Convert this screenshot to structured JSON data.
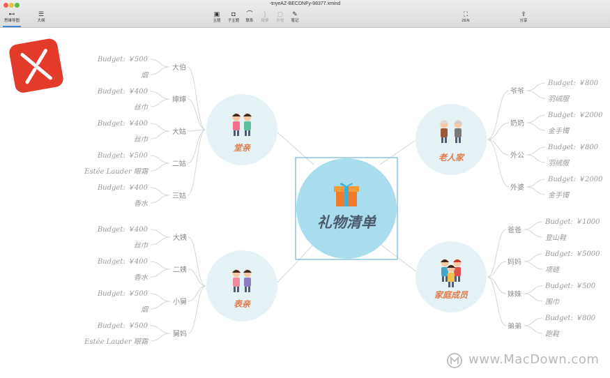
{
  "window": {
    "title": "-tnyeAZ-BECDNFy-98377.xmind"
  },
  "toolbar": {
    "mindmap_label": "思维导图",
    "outline_label": "大纲",
    "topic_label": "主题",
    "subtopic_label": "子主题",
    "relation_label": "联系",
    "summary_label": "概要",
    "boundary_label": "外框",
    "note_label": "笔记",
    "zen_label": "ZEN",
    "share_label": "分享"
  },
  "colors": {
    "accent": "#3a86d4",
    "bubble": "#e4f2f6",
    "center": "#a9dcec",
    "branch_label": "#e07a4a",
    "leaf_text": "#9a9a9a",
    "line": "#cfd8dc"
  },
  "mindmap": {
    "center": {
      "label": "礼物清单",
      "icon": "gift-icon"
    },
    "branches": [
      {
        "label": "堂亲",
        "icon": "siblings-icon",
        "children": [
          {
            "label": "大伯",
            "leaves": [
              "Budget: ￥500",
              "烟"
            ]
          },
          {
            "label": "婶婶",
            "leaves": [
              "Budget: ￥400",
              "丝巾"
            ]
          },
          {
            "label": "大姑",
            "leaves": [
              "Budget: ￥400",
              "丝巾"
            ]
          },
          {
            "label": "二姑",
            "leaves": [
              "Budget: ￥500",
              "Estée Lauder 眼霜"
            ]
          },
          {
            "label": "三姑",
            "leaves": [
              "Budget: ￥400",
              "香水"
            ]
          }
        ]
      },
      {
        "label": "表亲",
        "icon": "cousins-icon",
        "children": [
          {
            "label": "大姨",
            "leaves": [
              "Budget: ￥400",
              "丝巾"
            ]
          },
          {
            "label": "二姨",
            "leaves": [
              "Budget: ￥400",
              "香水"
            ]
          },
          {
            "label": "小舅",
            "leaves": [
              "Budget: ￥500",
              "烟"
            ]
          },
          {
            "label": "舅妈",
            "leaves": [
              "Budget: ￥500",
              "Estée Lauder 眼霜"
            ]
          }
        ]
      },
      {
        "label": "老人家",
        "icon": "elderly-icon",
        "children": [
          {
            "label": "爷爷",
            "leaves": [
              "Budget: ￥800",
              "羽绒服"
            ]
          },
          {
            "label": "奶奶",
            "leaves": [
              "Budget: ￥2000",
              "金手镯"
            ]
          },
          {
            "label": "外公",
            "leaves": [
              "Budget: ￥800",
              "羽绒服"
            ]
          },
          {
            "label": "外婆",
            "leaves": [
              "Budget: ￥2000",
              "金手镯"
            ]
          }
        ]
      },
      {
        "label": "家庭成员",
        "icon": "family-icon",
        "children": [
          {
            "label": "爸爸",
            "leaves": [
              "Budget: ￥1000",
              "登山鞋"
            ]
          },
          {
            "label": "妈妈",
            "leaves": [
              "Budget: ￥5000",
              "项链"
            ]
          },
          {
            "label": "妹妹",
            "leaves": [
              "Budget: ￥500",
              "围巾"
            ]
          },
          {
            "label": "弟弟",
            "leaves": [
              "Budget: ￥800",
              "跑鞋"
            ]
          }
        ]
      }
    ]
  },
  "watermark": {
    "text": "www.MacDown.com"
  }
}
